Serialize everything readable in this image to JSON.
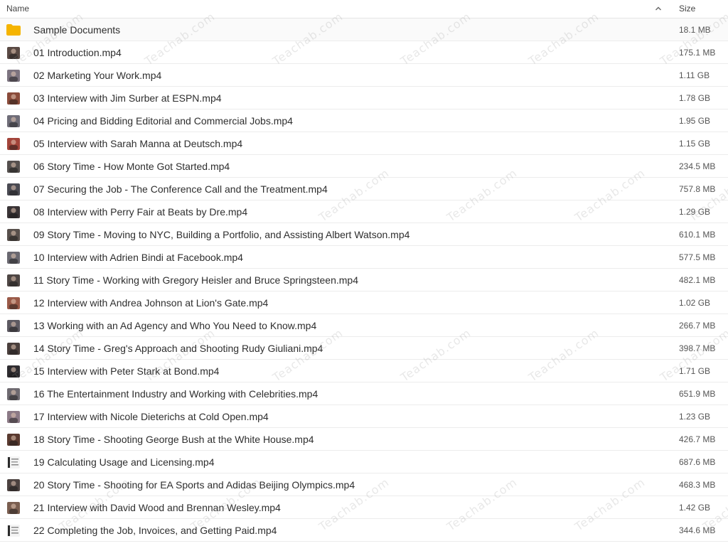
{
  "header": {
    "name_label": "Name",
    "size_label": "Size",
    "sort_icon": "chevron-up-icon"
  },
  "watermark_text": "Teachab.com",
  "files": [
    {
      "name": "Sample Documents",
      "size": "18.1 MB",
      "type": "folder",
      "color": "#f5b400"
    },
    {
      "name": "01 Introduction.mp4",
      "size": "175.1 MB",
      "type": "video",
      "color": "#5a4a44"
    },
    {
      "name": "02 Marketing Your Work.mp4",
      "size": "1.11 GB",
      "type": "video",
      "color": "#7d7480"
    },
    {
      "name": "03 Interview with Jim Surber at ESPN.mp4",
      "size": "1.78 GB",
      "type": "video",
      "color": "#8a4b3a"
    },
    {
      "name": "04 Pricing and Bidding Editorial and Commercial Jobs.mp4",
      "size": "1.95 GB",
      "type": "video",
      "color": "#6f6d78"
    },
    {
      "name": "05 Interview with Sarah Manna at Deutsch.mp4",
      "size": "1.15 GB",
      "type": "video",
      "color": "#a3443a"
    },
    {
      "name": "06 Story Time - How Monte Got Started.mp4",
      "size": "234.5 MB",
      "type": "video",
      "color": "#55504e"
    },
    {
      "name": "07 Securing the Job - The Conference Call and the Treatment.mp4",
      "size": "757.8 MB",
      "type": "video",
      "color": "#4a4a52"
    },
    {
      "name": "08 Interview with Perry Fair at Beats by Dre.mp4",
      "size": "1.29 GB",
      "type": "video",
      "color": "#3a3436"
    },
    {
      "name": "09 Story Time - Moving to NYC, Building a Portfolio, and Assisting Albert Watson.mp4",
      "size": "610.1 MB",
      "type": "video",
      "color": "#58504c"
    },
    {
      "name": "10 Interview with Adrien Bindi at Facebook.mp4",
      "size": "577.5 MB",
      "type": "video",
      "color": "#6a6870"
    },
    {
      "name": "11 Story Time - Working with Gregory Heisler and Bruce Springsteen.mp4",
      "size": "482.1 MB",
      "type": "video",
      "color": "#4e4644"
    },
    {
      "name": "12 Interview with Andrea Johnson at Lion's Gate.mp4",
      "size": "1.02 GB",
      "type": "video",
      "color": "#9a5a48"
    },
    {
      "name": "13 Working with an Ad Agency and Who You Need to Know.mp4",
      "size": "266.7 MB",
      "type": "video",
      "color": "#5d5a62"
    },
    {
      "name": "14 Story Time - Greg's Approach and Shooting Rudy Giuliani.mp4",
      "size": "398.7 MB",
      "type": "video",
      "color": "#4a3f3c"
    },
    {
      "name": "15 Interview with Peter Stark at Bond.mp4",
      "size": "1.71 GB",
      "type": "video",
      "color": "#2e2c30"
    },
    {
      "name": "16 The Entertainment Industry and Working with Celebrities.mp4",
      "size": "651.9 MB",
      "type": "video",
      "color": "#6e6a70"
    },
    {
      "name": "17 Interview with Nicole Dieterichs at Cold Open.mp4",
      "size": "1.23 GB",
      "type": "video",
      "color": "#8c7a86"
    },
    {
      "name": "18 Story Time - Shooting George Bush at the White House.mp4",
      "size": "426.7 MB",
      "type": "video",
      "color": "#5a3a30"
    },
    {
      "name": "19 Calculating Usage and Licensing.mp4",
      "size": "687.6 MB",
      "type": "document-video",
      "color": "#d8d8d8"
    },
    {
      "name": "20 Story Time - Shooting for EA Sports and Adidas Beijing Olympics.mp4",
      "size": "468.3 MB",
      "type": "video",
      "color": "#4c4240"
    },
    {
      "name": "21 Interview with David Wood and Brennan Wesley.mp4",
      "size": "1.42 GB",
      "type": "video",
      "color": "#7a5e50"
    },
    {
      "name": "22 Completing the Job, Invoices, and Getting Paid.mp4",
      "size": "344.6 MB",
      "type": "document-video",
      "color": "#cfcfcf"
    }
  ]
}
